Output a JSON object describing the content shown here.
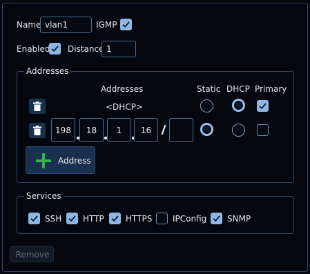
{
  "form": {
    "name_label": "Name",
    "name_value": "vlan1",
    "igmp_label": "IGMP",
    "igmp_checked": true,
    "enabled_label": "Enabled",
    "enabled_checked": true,
    "distance_label": "Distance",
    "distance_value": "1"
  },
  "addresses": {
    "group_title": "Addresses",
    "column_header": "Addresses",
    "static_header": "Static",
    "dhcp_header": "DHCP",
    "primary_header": "Primary",
    "rows": [
      {
        "text": "<DHCP>",
        "static": false,
        "dhcp": true,
        "primary": true
      },
      {
        "octets": [
          "198",
          "18",
          "1",
          "16"
        ],
        "prefix": "",
        "static": true,
        "dhcp": false,
        "primary": false
      }
    ],
    "add_button_label": "Address"
  },
  "services": {
    "group_title": "Services",
    "items": [
      {
        "label": "SSH",
        "checked": true
      },
      {
        "label": "HTTP",
        "checked": true
      },
      {
        "label": "HTTPS",
        "checked": true
      },
      {
        "label": "IPConfig",
        "checked": false
      },
      {
        "label": "SNMP",
        "checked": true
      }
    ]
  },
  "footer": {
    "remove_label": "Remove"
  },
  "colors": {
    "accent": "#8fb7e4",
    "border": "#2f4b6d",
    "add_icon": "#35b04a",
    "background": "#05080e"
  },
  "icons": [
    "trash-icon",
    "plus-icon",
    "checkmark-icon"
  ]
}
